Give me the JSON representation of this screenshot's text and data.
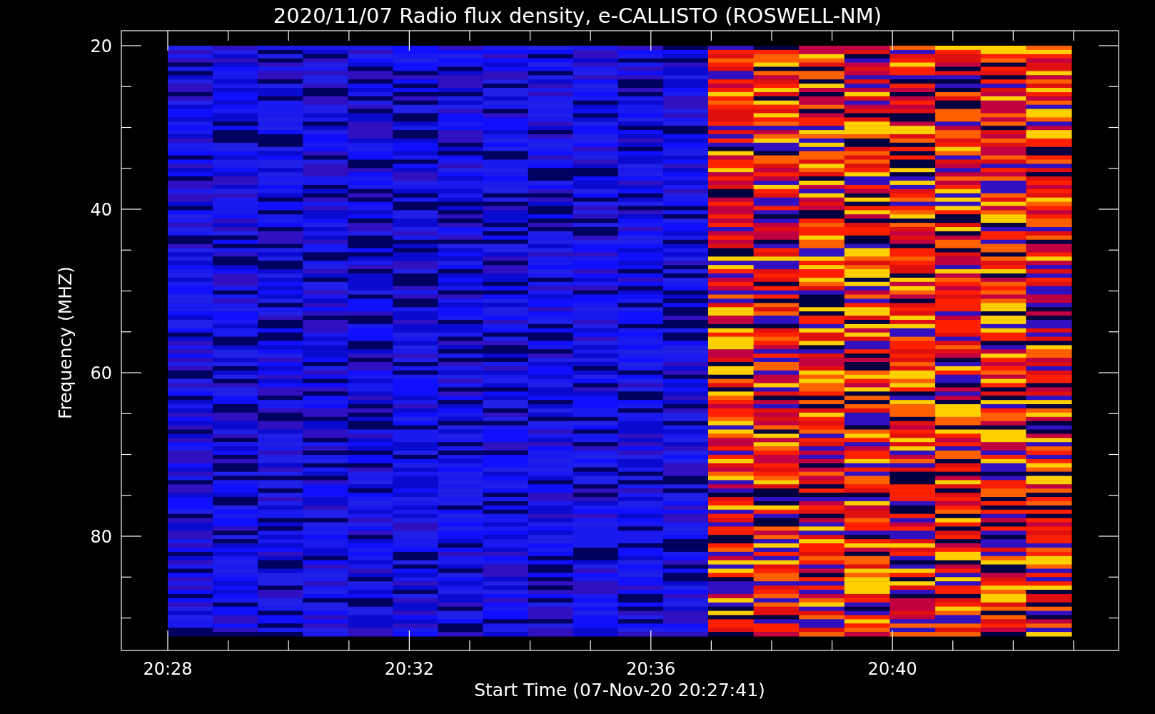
{
  "title": "2020/11/07  Radio flux density, e-CALLISTO (ROSWELL-NM)",
  "y_axis": {
    "label": "Frequency (MHZ)",
    "ticks": [
      "20",
      "40",
      "60",
      "80"
    ]
  },
  "x_axis": {
    "label": "Start Time (07-Nov-20 20:27:41)",
    "ticks": [
      "20:28",
      "20:32",
      "20:36",
      "20:40"
    ]
  }
}
